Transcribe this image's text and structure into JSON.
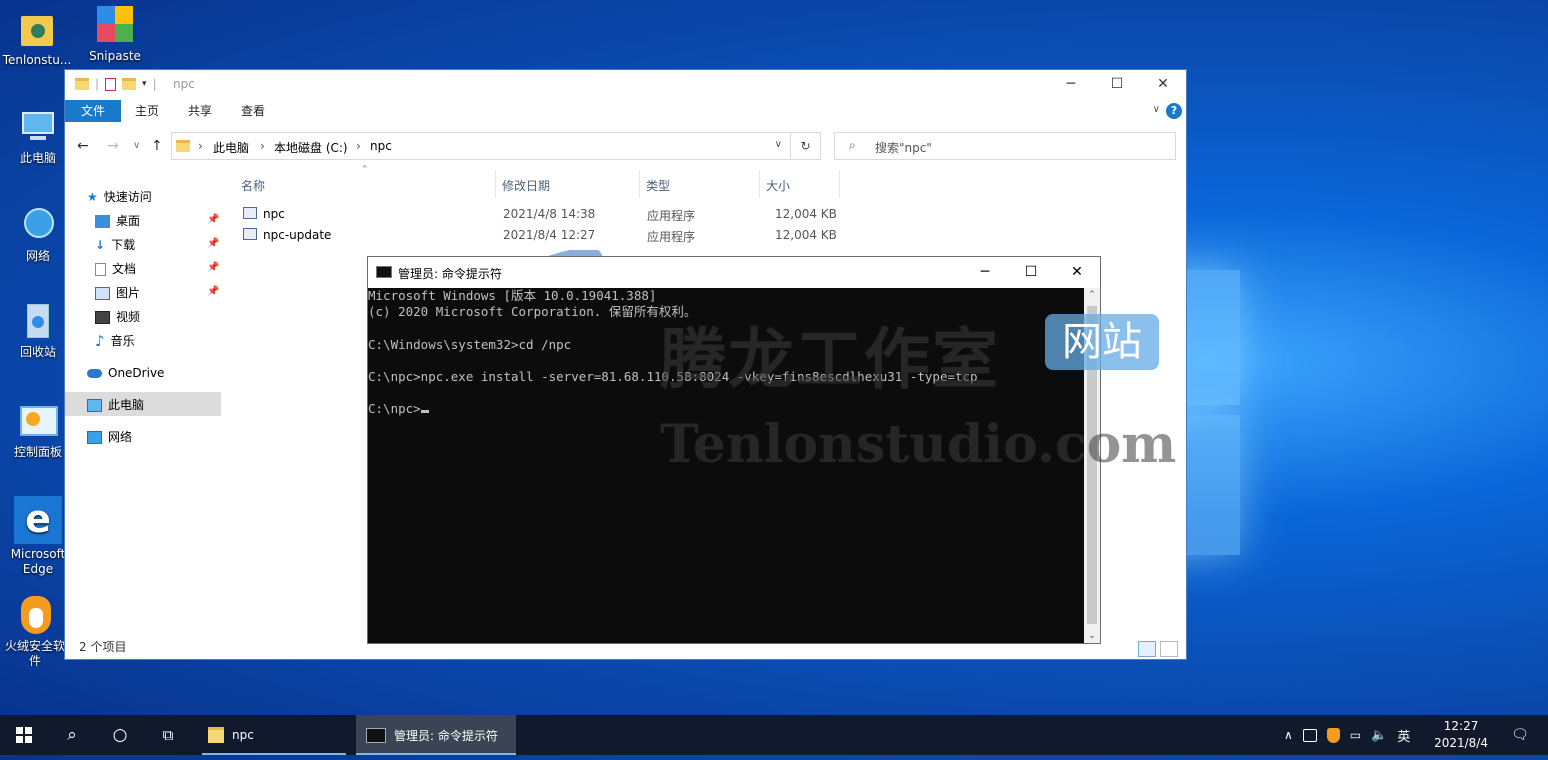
{
  "desktop": {
    "icons": [
      {
        "label": "Tenlonstu..."
      },
      {
        "label": "Snipaste -..."
      },
      {
        "label": "此电脑"
      },
      {
        "label": "网络"
      },
      {
        "label": "回收站"
      },
      {
        "label": "控制面板"
      },
      {
        "label": "Microsoft Edge"
      },
      {
        "label": "火绒安全软件"
      }
    ]
  },
  "explorer": {
    "title": "npc",
    "ribbon": {
      "file": "文件",
      "home": "主页",
      "share": "共享",
      "view": "查看"
    },
    "address": {
      "seg1": "此电脑",
      "seg2": "本地磁盘 (C:)",
      "seg3": "npc"
    },
    "search_placeholder": "搜索\"npc\"",
    "sidebar": {
      "quick": "快速访问",
      "desktop": "桌面",
      "downloads": "下载",
      "documents": "文档",
      "pictures": "图片",
      "videos": "视频",
      "music": "音乐",
      "onedrive": "OneDrive",
      "thispc": "此电脑",
      "network": "网络"
    },
    "columns": {
      "name": "名称",
      "date": "修改日期",
      "type": "类型",
      "size": "大小"
    },
    "files": [
      {
        "name": "npc",
        "date": "2021/4/8 14:38",
        "type": "应用程序",
        "size": "12,004 KB"
      },
      {
        "name": "npc-update",
        "date": "2021/8/4 12:27",
        "type": "应用程序",
        "size": "12,004 KB"
      }
    ],
    "status": "2 个项目"
  },
  "cmd": {
    "title": "管理员: 命令提示符",
    "lines": [
      "Microsoft Windows [版本 10.0.19041.388]",
      "(c) 2020 Microsoft Corporation. 保留所有权利。",
      "",
      "C:\\Windows\\system32>cd /npc",
      "",
      "C:\\npc>npc.exe install -server=81.68.110.58:8024 -vkey=fins8escdlhexu31 -type=tcp",
      "",
      "C:\\npc>"
    ]
  },
  "watermark": {
    "cn": "腾龙工作室",
    "box": "网站",
    "en": "Tenlonstudio.com"
  },
  "taskbar": {
    "app1": "npc",
    "app2": "管理员: 命令提示符",
    "ime": "英",
    "time": "12:27",
    "date": "2021/8/4"
  }
}
